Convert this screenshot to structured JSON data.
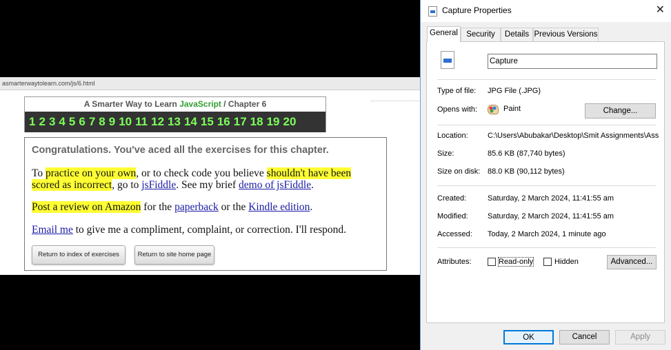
{
  "capture": {
    "url": "asmarterwaytolearn.com/js/6.html",
    "chapter_header": {
      "prefix": "A Smarter Way to Learn ",
      "brand": "JavaScript",
      "suffix": " / Chapter 6",
      "numbers": [
        "1",
        "2",
        "3",
        "4",
        "5",
        "6",
        "7",
        "8",
        "9",
        "10",
        "11",
        "12",
        "13",
        "14",
        "15",
        "16",
        "17",
        "18",
        "19",
        "20"
      ]
    },
    "congrats": {
      "heading": "Congratulations. You've aced all the exercises for this chapter.",
      "p1_a": "To ",
      "p1_hl1": "practice on your own",
      "p1_b": ", or to check code you believe ",
      "p1_hl2": "shouldn't have been scored as incorrect",
      "p1_c": ", go to ",
      "p1_link1": "jsFiddle",
      "p1_d": ". See my brief ",
      "p1_link2": "demo of jsFiddle",
      "p1_e": ".",
      "p2_hl": "Post a review on Amazon",
      "p2_a": " for the ",
      "p2_link1": "paperback",
      "p2_b": " or the ",
      "p2_link2": "Kindle edition",
      "p2_c": ".",
      "p3_link": "Email me",
      "p3_text": " to give me a compliment, complaint, or correction. I'll respond.",
      "btn_index": "Return to index of exercises",
      "btn_home": "Return to site home page"
    }
  },
  "dialog": {
    "title": "Capture Properties",
    "close_glyph": "✕",
    "tabs": [
      "General",
      "Security",
      "Details",
      "Previous Versions"
    ],
    "file_name": "Capture",
    "type_label": "Type of file:",
    "type_value": "JPG File (.JPG)",
    "opens_label": "Opens with:",
    "opens_value": "Paint",
    "change_button": "Change...",
    "location_label": "Location:",
    "location_value": "C:\\Users\\Abubakar\\Desktop\\Smit Assignments\\Ass",
    "size_label": "Size:",
    "size_value": "85.6 KB (87,740 bytes)",
    "size_disk_label": "Size on disk:",
    "size_disk_value": "88.0 KB (90,112 bytes)",
    "created_label": "Created:",
    "created_value": "Saturday, 2 March 2024, 11:41:55 am",
    "modified_label": "Modified:",
    "modified_value": "Saturday, 2 March 2024, 11:41:55 am",
    "accessed_label": "Accessed:",
    "accessed_value": "Today, 2 March 2024, 1 minute ago",
    "attributes_label": "Attributes:",
    "readonly_label": "Read-only",
    "hidden_label": "Hidden",
    "advanced_button": "Advanced...",
    "ok_button": "OK",
    "cancel_button": "Cancel",
    "apply_button": "Apply",
    "colors": {
      "accent": "#0078d7",
      "highlight": "#ffff33",
      "chapter_number": "#7dff5a",
      "brand_green": "#2f9e2f"
    }
  }
}
